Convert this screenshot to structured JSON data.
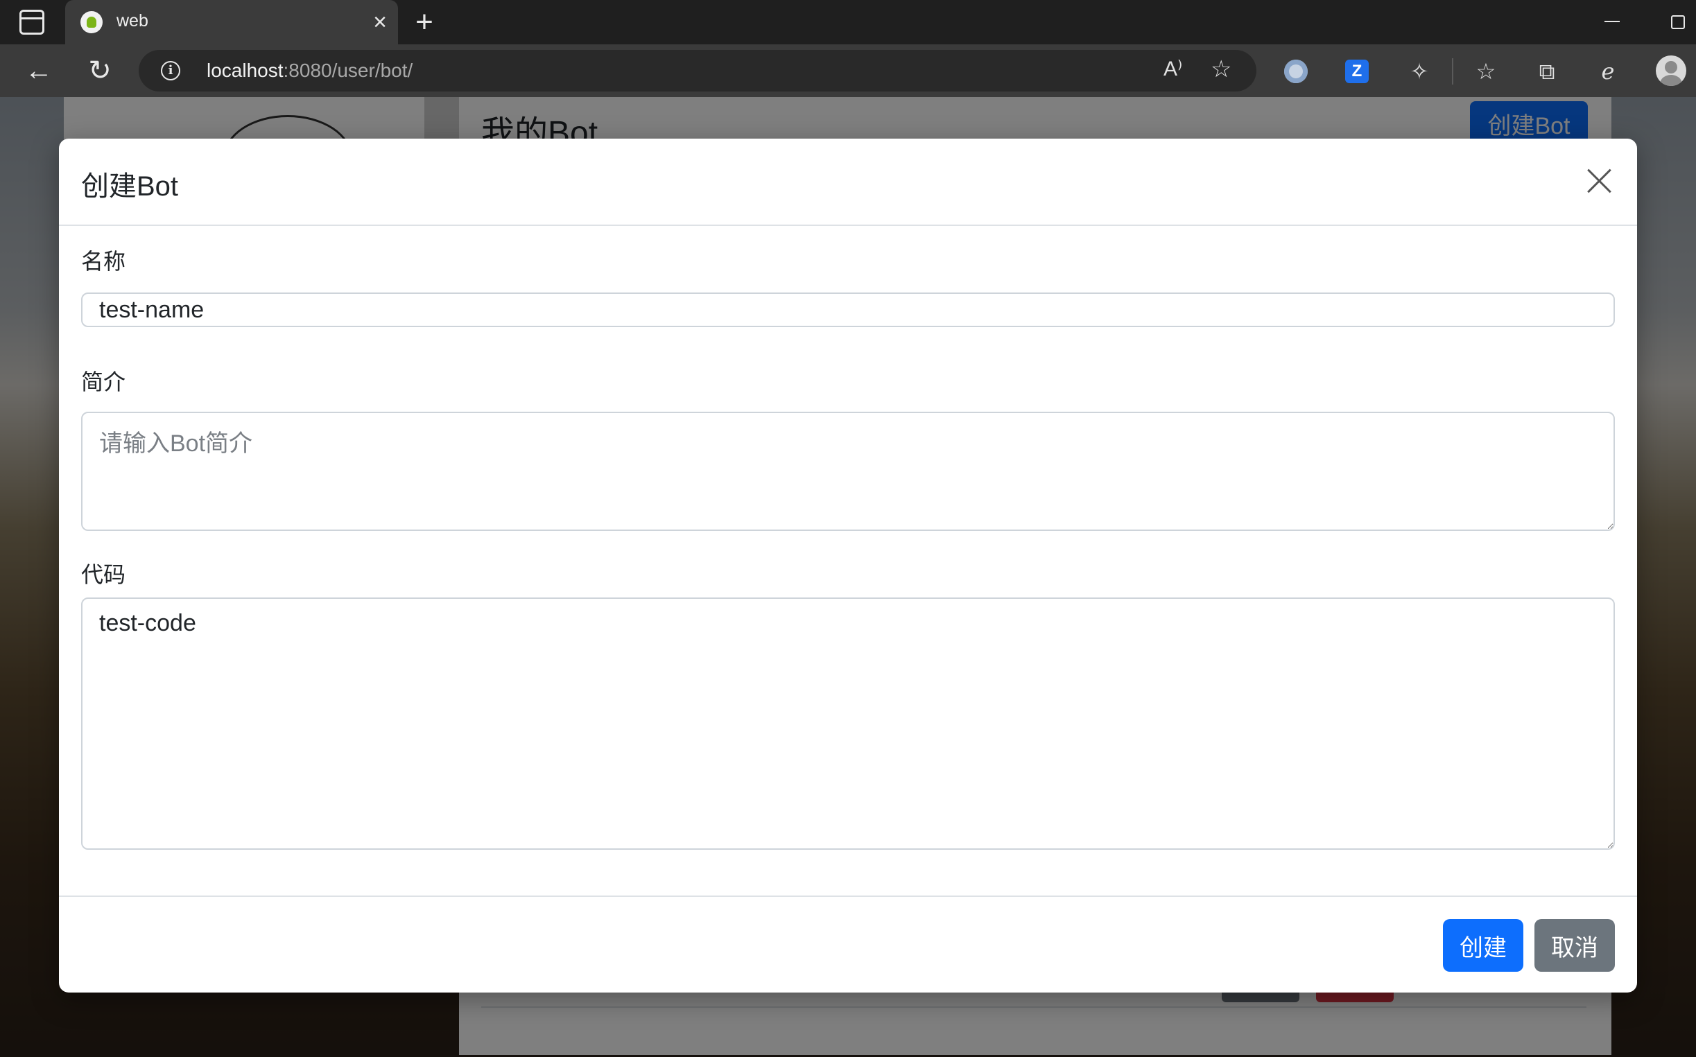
{
  "browser": {
    "tab_title": "web",
    "url_host": "localhost",
    "url_path": ":8080/user/bot/",
    "read_aloud_glyph": "A⁾",
    "icons": [
      "sidebar-icon",
      "favicon",
      "close-icon",
      "plus-icon",
      "minimize-icon",
      "restore-icon",
      "back-icon",
      "reload-icon",
      "info-icon",
      "read-aloud-icon",
      "favorite-add-icon",
      "extension-icon",
      "puzzle-icon",
      "favorites-icon",
      "collections-icon",
      "edge-icon",
      "profile-icon"
    ]
  },
  "page": {
    "title": "我的Bot",
    "create_button": "创建Bot"
  },
  "modal": {
    "title": "创建Bot",
    "fields": {
      "name": {
        "label": "名称",
        "value": "test-name"
      },
      "description": {
        "label": "简介",
        "value": "",
        "placeholder": "请输入Bot简介"
      },
      "code": {
        "label": "代码",
        "value": "test-code"
      }
    },
    "buttons": {
      "create": "创建",
      "cancel": "取消"
    }
  },
  "colors": {
    "primary": "#0d6efd",
    "secondary": "#6c757d",
    "danger": "#dc3545"
  }
}
